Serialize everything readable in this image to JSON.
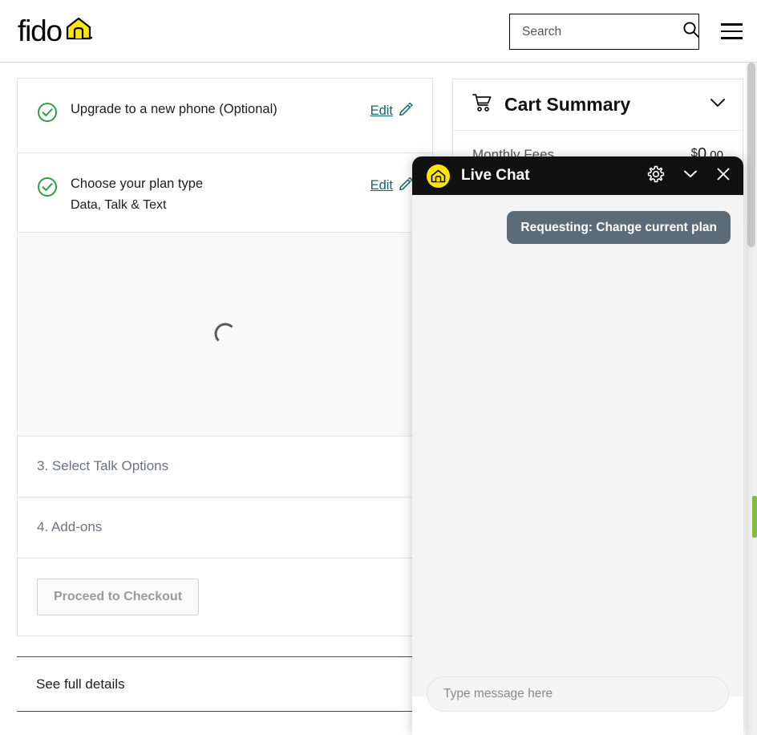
{
  "header": {
    "logo_text": "fido",
    "logo_icon": "house-icon",
    "search": {
      "placeholder": "Search",
      "value": "",
      "icon": "search-icon"
    },
    "menu_icon": "hamburger-menu-icon"
  },
  "checkout": {
    "steps": [
      {
        "status_icon": "check-circle-icon",
        "title": "Upgrade to a new phone (Optional)",
        "subtitle": "",
        "edit_label": "Edit",
        "edit_icon": "pencil-icon"
      },
      {
        "status_icon": "check-circle-icon",
        "title": "Choose your plan type",
        "subtitle": "Data, Talk & Text",
        "edit_label": "Edit",
        "edit_icon": "pencil-icon"
      }
    ],
    "loading": {
      "icon": "spinner-icon"
    },
    "pending_steps": [
      {
        "label": "3. Select Talk Options"
      },
      {
        "label": "4. Add-ons"
      }
    ],
    "checkout_button": {
      "label": "Proceed to Checkout",
      "disabled": true
    },
    "details_link": "See full details"
  },
  "cart": {
    "icon": "shopping-cart-icon",
    "title": "Cart Summary",
    "collapse_icon": "chevron-down-icon",
    "rows": [
      {
        "label": "Monthly Fees",
        "currency": "$",
        "whole": "0",
        "cents": ".00"
      }
    ]
  },
  "live_chat": {
    "avatar_icon": "fido-house-icon",
    "title": "Live Chat",
    "settings_icon": "gear-icon",
    "minimize_icon": "chevron-down-icon",
    "close_icon": "close-icon",
    "messages": [
      {
        "author": "user",
        "text": "Requesting: Change current plan"
      }
    ],
    "input": {
      "placeholder": "Type message here",
      "value": ""
    }
  },
  "feedback_tab": {
    "name": "feedback-tab"
  },
  "colors": {
    "brand_yellow": "#ffe600",
    "link_teal": "#11656e",
    "check_green": "#2e9e3e",
    "chat_header": "#111111",
    "msg_bubble": "#5b6b78",
    "feedback_green": "#85bb3c"
  }
}
